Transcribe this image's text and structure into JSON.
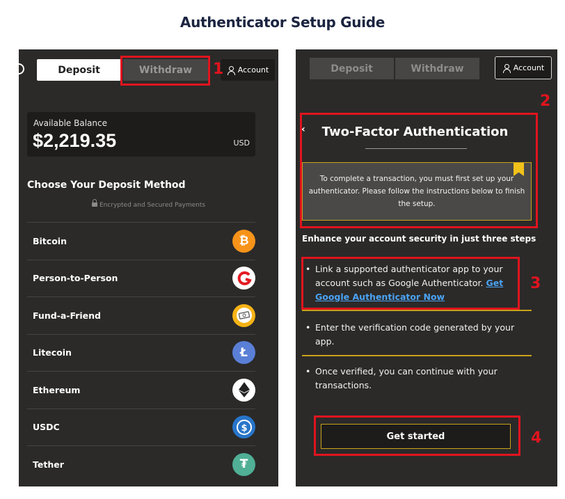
{
  "guide": {
    "title": "Authenticator Setup Guide"
  },
  "left_screen": {
    "tabs": {
      "deposit": "Deposit",
      "withdraw": "Withdraw"
    },
    "account_label": "Account",
    "balance": {
      "label": "Available Balance",
      "amount": "$2,219.35",
      "currency": "USD"
    },
    "method_heading": "Choose Your Deposit Method",
    "secure_note": "Encrypted and Secured Payments",
    "methods": [
      {
        "label": "Bitcoin",
        "icon": "bitcoin-icon",
        "glyph": "₿",
        "color": "#f7931a"
      },
      {
        "label": "Person-to-Person",
        "icon": "person-to-person-icon",
        "glyph": "",
        "color": "#e31b23"
      },
      {
        "label": "Fund-a-Friend",
        "icon": "fund-a-friend-icon",
        "glyph": "",
        "color": "#f5b316"
      },
      {
        "label": "Litecoin",
        "icon": "litecoin-icon",
        "glyph": "Ł",
        "color": "#5a7fd6"
      },
      {
        "label": "Ethereum",
        "icon": "ethereum-icon",
        "glyph": "",
        "color": "#ffffff"
      },
      {
        "label": "USDC",
        "icon": "usdc-icon",
        "glyph": "$",
        "color": "#2775ca"
      },
      {
        "label": "Tether",
        "icon": "tether-icon",
        "glyph": "₮",
        "color": "#50af95"
      }
    ]
  },
  "right_screen": {
    "tabs": {
      "deposit": "Deposit",
      "withdraw": "Withdraw"
    },
    "account_label": "Account",
    "title": "Two-Factor Authentication",
    "notice": "To complete a transaction, you must first set up your authenticator. Please follow the instructions below to finish the setup.",
    "enhance": "Enhance your account security in just three steps",
    "steps": [
      {
        "text": "Link a supported authenticator app to your account such as Google Authenticator. ",
        "link": "Get Google Authenticator Now"
      },
      {
        "text": "Enter the verification code generated by your app."
      },
      {
        "text": "Once verified, you can continue with your transactions."
      }
    ],
    "cta": "Get started"
  },
  "annotations": {
    "n1": "1",
    "n2": "2",
    "n3": "3",
    "n4": "4"
  },
  "colors": {
    "highlight": "#e0141e",
    "gold": "#c9a319",
    "panel": "#2b2a29",
    "link": "#4ba3f5"
  }
}
